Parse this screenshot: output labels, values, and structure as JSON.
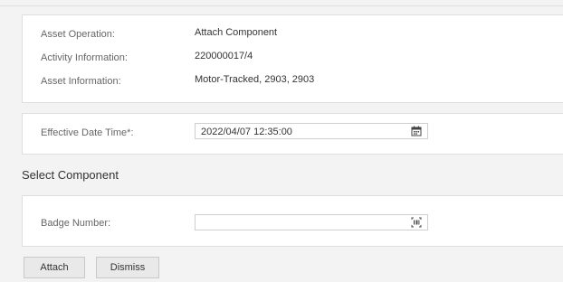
{
  "asset": {
    "operation_label": "Asset Operation:",
    "operation_value": "Attach Component",
    "activity_label": "Activity Information:",
    "activity_value": "220000017/4",
    "info_label": "Asset Information:",
    "info_value": "Motor-Tracked, 2903, 2903"
  },
  "effective": {
    "label": "Effective Date Time*:",
    "value": "2022/04/07 12:35:00",
    "icon": "calendar-icon"
  },
  "section": {
    "title": "Select Component"
  },
  "badge": {
    "label": "Badge Number:",
    "value": "",
    "icon": "barcode-scan-icon"
  },
  "actions": {
    "attach_label": "Attach",
    "dismiss_label": "Dismiss"
  }
}
